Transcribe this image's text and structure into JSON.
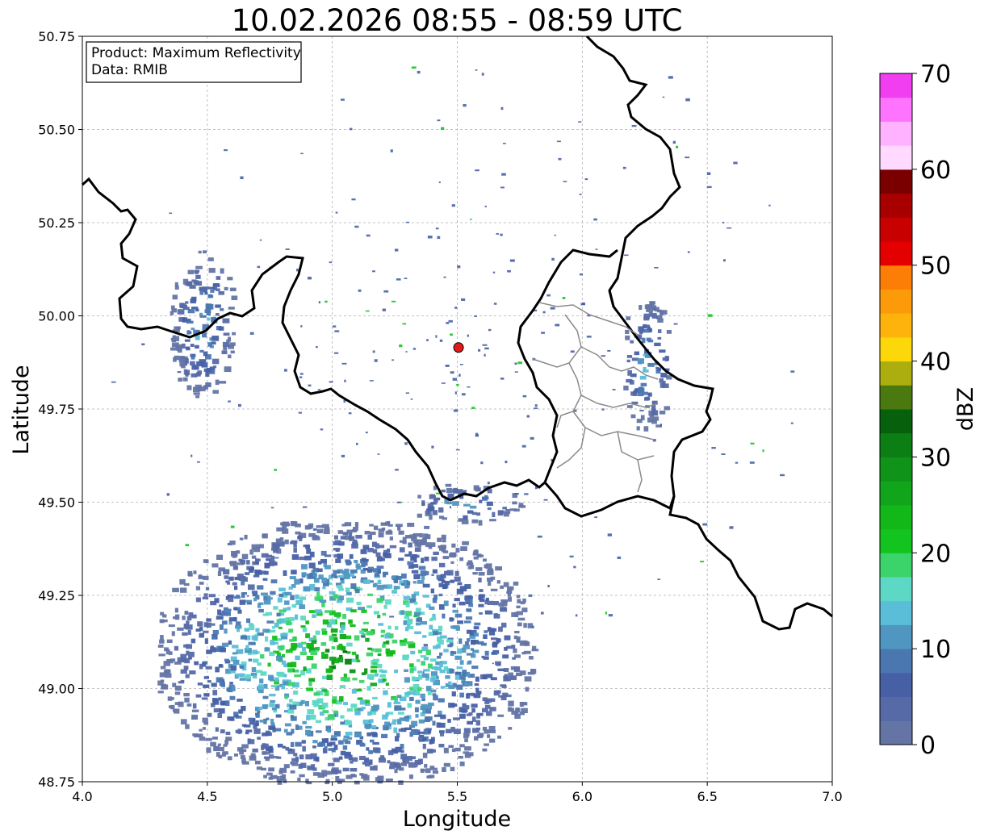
{
  "title": "10.02.2026 08:55 - 08:59 UTC",
  "info_box": {
    "product": "Product: Maximum Reflectivity",
    "data": "Data: RMIB"
  },
  "axes": {
    "x_label": "Longitude",
    "y_label": "Latitude",
    "x_range": [
      4.0,
      7.0
    ],
    "y_range": [
      48.75,
      50.75
    ],
    "x_ticks": [
      "4.0",
      "4.5",
      "5.0",
      "5.5",
      "6.0",
      "6.5",
      "7.0"
    ],
    "y_ticks": [
      "48.75",
      "49.00",
      "49.25",
      "49.50",
      "49.75",
      "50.00",
      "50.25",
      "50.50",
      "50.75"
    ],
    "grid": true
  },
  "colorbar": {
    "label": "dBZ",
    "range": [
      0,
      70
    ],
    "ticks": [
      "0",
      "10",
      "20",
      "30",
      "40",
      "50",
      "60",
      "70"
    ],
    "colors": [
      "#6475a5",
      "#566aa8",
      "#4760a5",
      "#4b77b1",
      "#4f96c1",
      "#5abed8",
      "#5ed8c6",
      "#3bd46a",
      "#14c41e",
      "#12b818",
      "#11a51b",
      "#0f9318",
      "#0b7f13",
      "#06600c",
      "#4a7a0f",
      "#abae0e",
      "#fcd80a",
      "#fdb30c",
      "#fd9a0a",
      "#fc7e06",
      "#e40000",
      "#c80000",
      "#a80000",
      "#7a0000",
      "#ffd9ff",
      "#ffb2ff",
      "#ff74ff",
      "#f03ef0"
    ]
  },
  "radar_site": {
    "lon": 5.505,
    "lat": 49.915,
    "color": "#e31a1c"
  },
  "chart_data": {
    "type": "heatmap",
    "title": "10.02.2026 08:55 - 08:59 UTC",
    "xlabel": "Longitude",
    "ylabel": "Latitude",
    "xlim": [
      4.0,
      7.0
    ],
    "ylim": [
      48.75,
      50.75
    ],
    "value_unit": "dBZ",
    "value_range": [
      0,
      70
    ],
    "echo_regions": [
      {
        "lon": [
          4.3,
          5.8
        ],
        "lat": [
          48.75,
          49.45
        ],
        "max_dbz": 30
      },
      {
        "lon": [
          4.35,
          4.6
        ],
        "lat": [
          49.78,
          50.18
        ],
        "max_dbz": 15
      },
      {
        "lon": [
          5.3,
          5.75
        ],
        "lat": [
          49.45,
          49.55
        ],
        "max_dbz": 15
      },
      {
        "lon": [
          6.15,
          6.35
        ],
        "lat": [
          49.7,
          50.05
        ],
        "max_dbz": 15
      }
    ]
  }
}
